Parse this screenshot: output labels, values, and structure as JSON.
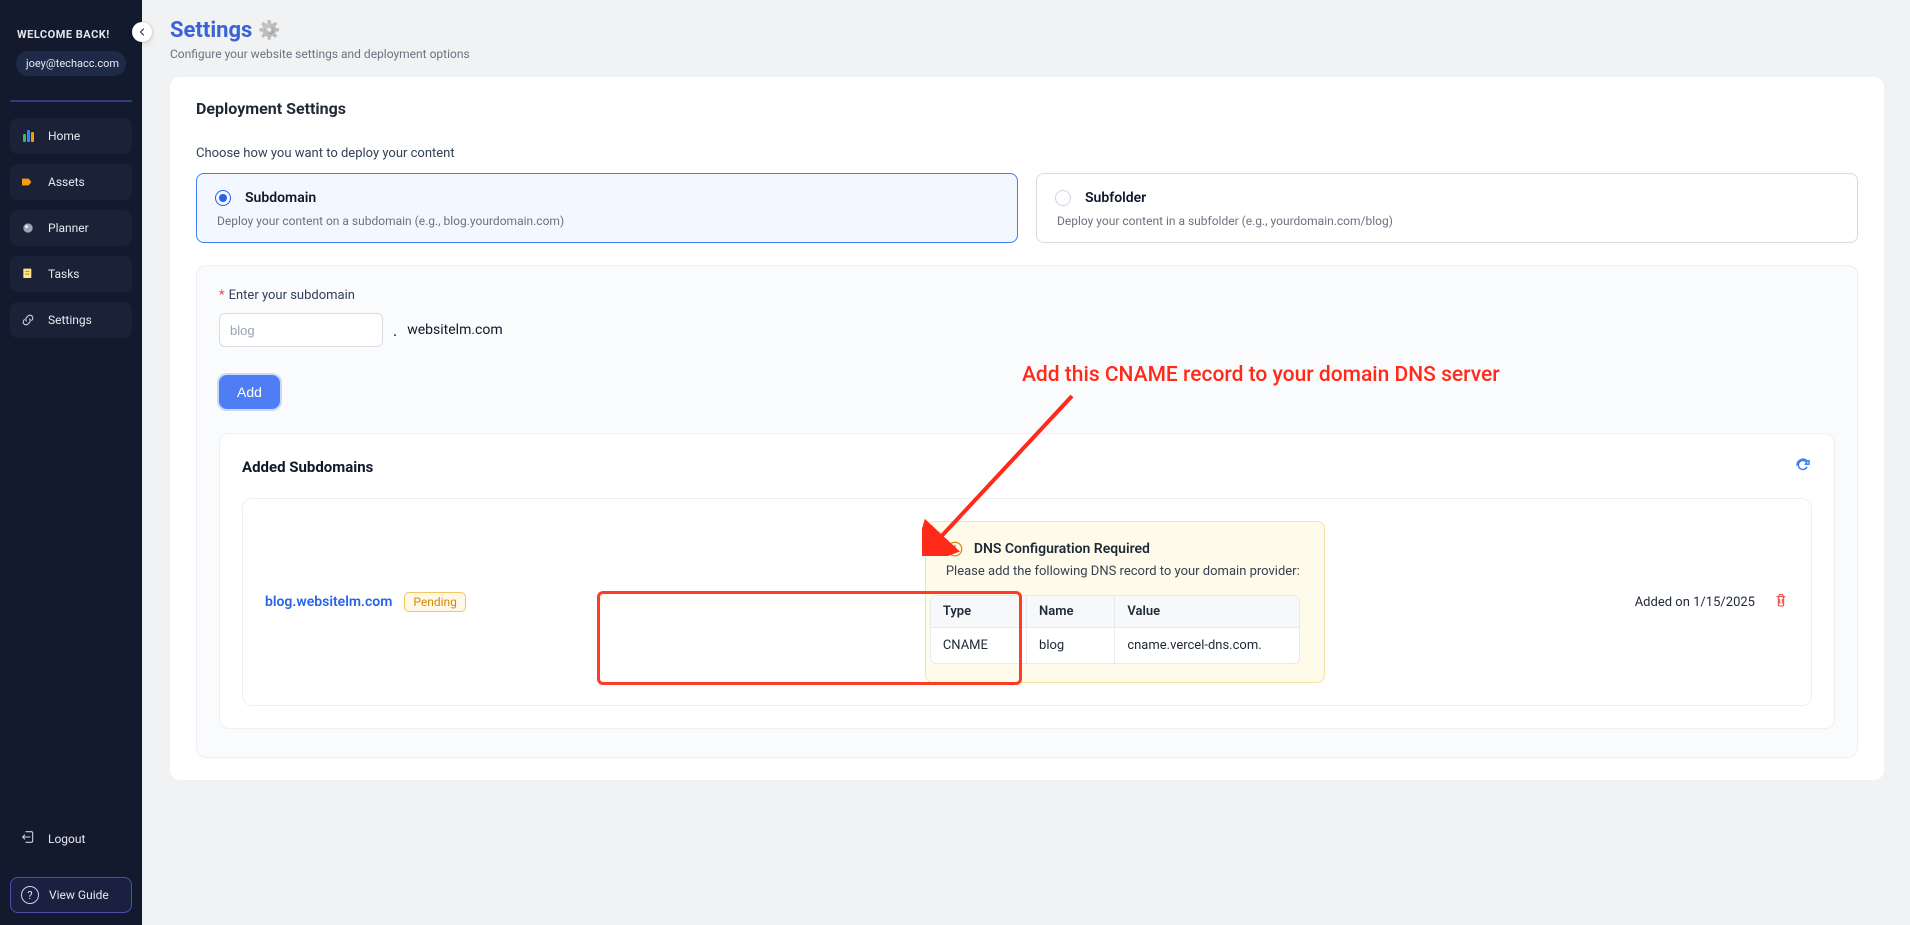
{
  "sidebar": {
    "welcome": "WELCOME BACK!",
    "email": "joey@techacc.com",
    "items": [
      {
        "label": "Home"
      },
      {
        "label": "Assets"
      },
      {
        "label": "Planner"
      },
      {
        "label": "Tasks"
      },
      {
        "label": "Settings"
      }
    ],
    "logout": "Logout",
    "view_guide": "View Guide"
  },
  "page": {
    "title": "Settings",
    "subtitle": "Configure your website settings and deployment options"
  },
  "deployment": {
    "heading": "Deployment Settings",
    "description": "Choose how you want to deploy your content",
    "options": {
      "subdomain": {
        "title": "Subdomain",
        "desc": "Deploy your content on a subdomain (e.g., blog.yourdomain.com)"
      },
      "subfolder": {
        "title": "Subfolder",
        "desc": "Deploy your content in a subfolder (e.g., yourdomain.com/blog)"
      }
    }
  },
  "subdomain_form": {
    "label": "Enter your subdomain",
    "placeholder": "blog",
    "domain": "websitelm.com",
    "add_btn": "Add"
  },
  "added": {
    "heading": "Added Subdomains",
    "items": [
      {
        "name": "blog.websitelm.com",
        "status": "Pending",
        "added_on": "Added on 1/15/2025",
        "dns": {
          "title": "DNS Configuration Required",
          "desc": "Please add the following DNS record to your domain provider:",
          "headers": {
            "type": "Type",
            "name": "Name",
            "value": "Value"
          },
          "record": {
            "type": "CNAME",
            "name": "blog",
            "value": "cname.vercel-dns.com."
          }
        }
      }
    ]
  },
  "annotation": {
    "text": "Add this CNAME record to your domain DNS server"
  }
}
